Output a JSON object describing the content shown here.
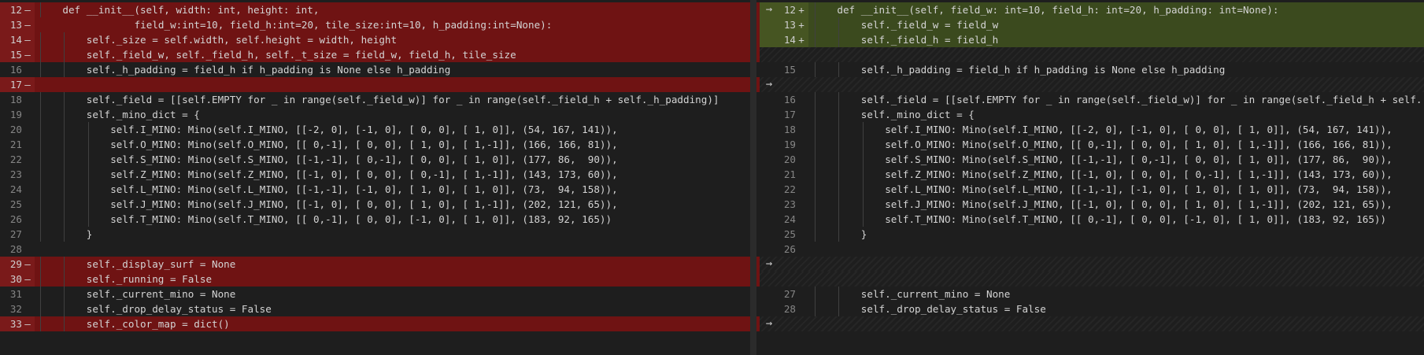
{
  "left": {
    "lines": [
      {
        "n": "12",
        "m": "—",
        "t": "removed",
        "c": "def __init__(self, width: int, height: int,",
        "ind": 1
      },
      {
        "n": "13",
        "m": "—",
        "t": "removed",
        "c": "field_w:int=10, field_h:int=20, tile_size:int=10, h_padding:int=None):",
        "ind": 0,
        "pad": "                "
      },
      {
        "n": "14",
        "m": "—",
        "t": "removed",
        "c": "self._size = self.width, self.height = width, height",
        "ind": 2
      },
      {
        "n": "15",
        "m": "—",
        "t": "removed",
        "c": "self._field_w, self._field_h, self._t_size = field_w, field_h, tile_size",
        "ind": 2
      },
      {
        "n": "16",
        "m": "",
        "t": "normal",
        "c": "self._h_padding = field_h if h_padding is None else h_padding",
        "ind": 2
      },
      {
        "n": "17",
        "m": "—",
        "t": "removed",
        "c": "",
        "ind": 0
      },
      {
        "n": "18",
        "m": "",
        "t": "normal",
        "c": "self._field = [[self.EMPTY for _ in range(self._field_w)] for _ in range(self._field_h + self._h_padding)]",
        "ind": 2
      },
      {
        "n": "19",
        "m": "",
        "t": "normal",
        "c": "self._mino_dict = {",
        "ind": 2
      },
      {
        "n": "20",
        "m": "",
        "t": "normal",
        "c": "self.I_MINO: Mino(self.I_MINO, [[-2, 0], [-1, 0], [ 0, 0], [ 1, 0]], (54, 167, 141)),",
        "ind": 3
      },
      {
        "n": "21",
        "m": "",
        "t": "normal",
        "c": "self.O_MINO: Mino(self.O_MINO, [[ 0,-1], [ 0, 0], [ 1, 0], [ 1,-1]], (166, 166, 81)),",
        "ind": 3
      },
      {
        "n": "22",
        "m": "",
        "t": "normal",
        "c": "self.S_MINO: Mino(self.S_MINO, [[-1,-1], [ 0,-1], [ 0, 0], [ 1, 0]], (177, 86,  90)),",
        "ind": 3
      },
      {
        "n": "23",
        "m": "",
        "t": "normal",
        "c": "self.Z_MINO: Mino(self.Z_MINO, [[-1, 0], [ 0, 0], [ 0,-1], [ 1,-1]], (143, 173, 60)),",
        "ind": 3
      },
      {
        "n": "24",
        "m": "",
        "t": "normal",
        "c": "self.L_MINO: Mino(self.L_MINO, [[-1,-1], [-1, 0], [ 1, 0], [ 1, 0]], (73,  94, 158)),",
        "ind": 3
      },
      {
        "n": "25",
        "m": "",
        "t": "normal",
        "c": "self.J_MINO: Mino(self.J_MINO, [[-1, 0], [ 0, 0], [ 1, 0], [ 1,-1]], (202, 121, 65)),",
        "ind": 3
      },
      {
        "n": "26",
        "m": "",
        "t": "normal",
        "c": "self.T_MINO: Mino(self.T_MINO, [[ 0,-1], [ 0, 0], [-1, 0], [ 1, 0]], (183, 92, 165))",
        "ind": 3
      },
      {
        "n": "27",
        "m": "",
        "t": "normal",
        "c": "}",
        "ind": 2
      },
      {
        "n": "28",
        "m": "",
        "t": "normal",
        "c": "",
        "ind": 0
      },
      {
        "n": "29",
        "m": "—",
        "t": "removed",
        "c": "self._display_surf = None",
        "ind": 2
      },
      {
        "n": "30",
        "m": "—",
        "t": "removed",
        "c": "self._running = False",
        "ind": 2
      },
      {
        "n": "31",
        "m": "",
        "t": "normal",
        "c": "self._current_mino = None",
        "ind": 2
      },
      {
        "n": "32",
        "m": "",
        "t": "normal",
        "c": "self._drop_delay_status = False",
        "ind": 2
      },
      {
        "n": "33",
        "m": "—",
        "t": "removed",
        "c": "self._color_map = dict()",
        "ind": 2
      }
    ]
  },
  "right": {
    "lines": [
      {
        "n": "12",
        "m": "+",
        "t": "added",
        "c": "def __init__(self, field_w: int=10, field_h: int=20, h_padding: int=None):",
        "ind": 1
      },
      {
        "n": "13",
        "m": "+",
        "t": "added",
        "c": "self._field_w = field_w",
        "ind": 2
      },
      {
        "n": "14",
        "m": "+",
        "t": "added",
        "c": "self._field_h = field_h",
        "ind": 2
      },
      {
        "n": "",
        "m": "",
        "t": "filler",
        "c": "",
        "ind": 0
      },
      {
        "n": "15",
        "m": "",
        "t": "normal",
        "c": "self._h_padding = field_h if h_padding is None else h_padding",
        "ind": 2
      },
      {
        "n": "",
        "m": "",
        "t": "filler",
        "c": "",
        "ind": 0
      },
      {
        "n": "16",
        "m": "",
        "t": "normal",
        "c": "self._field = [[self.EMPTY for _ in range(self._field_w)] for _ in range(self._field_h + self.",
        "ind": 2
      },
      {
        "n": "17",
        "m": "",
        "t": "normal",
        "c": "self._mino_dict = {",
        "ind": 2
      },
      {
        "n": "18",
        "m": "",
        "t": "normal",
        "c": "self.I_MINO: Mino(self.I_MINO, [[-2, 0], [-1, 0], [ 0, 0], [ 1, 0]], (54, 167, 141)),",
        "ind": 3
      },
      {
        "n": "19",
        "m": "",
        "t": "normal",
        "c": "self.O_MINO: Mino(self.O_MINO, [[ 0,-1], [ 0, 0], [ 1, 0], [ 1,-1]], (166, 166, 81)),",
        "ind": 3
      },
      {
        "n": "20",
        "m": "",
        "t": "normal",
        "c": "self.S_MINO: Mino(self.S_MINO, [[-1,-1], [ 0,-1], [ 0, 0], [ 1, 0]], (177, 86,  90)),",
        "ind": 3
      },
      {
        "n": "21",
        "m": "",
        "t": "normal",
        "c": "self.Z_MINO: Mino(self.Z_MINO, [[-1, 0], [ 0, 0], [ 0,-1], [ 1,-1]], (143, 173, 60)),",
        "ind": 3
      },
      {
        "n": "22",
        "m": "",
        "t": "normal",
        "c": "self.L_MINO: Mino(self.L_MINO, [[-1,-1], [-1, 0], [ 1, 0], [ 1, 0]], (73,  94, 158)),",
        "ind": 3
      },
      {
        "n": "23",
        "m": "",
        "t": "normal",
        "c": "self.J_MINO: Mino(self.J_MINO, [[-1, 0], [ 0, 0], [ 1, 0], [ 1,-1]], (202, 121, 65)),",
        "ind": 3
      },
      {
        "n": "24",
        "m": "",
        "t": "normal",
        "c": "self.T_MINO: Mino(self.T_MINO, [[ 0,-1], [ 0, 0], [-1, 0], [ 1, 0]], (183, 92, 165))",
        "ind": 3
      },
      {
        "n": "25",
        "m": "",
        "t": "normal",
        "c": "}",
        "ind": 2
      },
      {
        "n": "26",
        "m": "",
        "t": "normal",
        "c": "",
        "ind": 0
      },
      {
        "n": "",
        "m": "",
        "t": "filler",
        "c": "",
        "ind": 0
      },
      {
        "n": "",
        "m": "",
        "t": "filler",
        "c": "",
        "ind": 0
      },
      {
        "n": "27",
        "m": "",
        "t": "normal",
        "c": "self._current_mino = None",
        "ind": 2
      },
      {
        "n": "28",
        "m": "",
        "t": "normal",
        "c": "self._drop_delay_status = False",
        "ind": 2
      },
      {
        "n": "",
        "m": "",
        "t": "filler",
        "c": "",
        "ind": 0
      }
    ]
  },
  "arrows": [
    {
      "row": 0,
      "glyph": "→"
    },
    {
      "row": 5,
      "glyph": "→"
    },
    {
      "row": 17,
      "glyph": "→"
    },
    {
      "row": 21,
      "glyph": "→"
    }
  ],
  "colors": {
    "removed": "#6f1313",
    "added": "#3b4a1e",
    "background": "#1e1e1e"
  }
}
